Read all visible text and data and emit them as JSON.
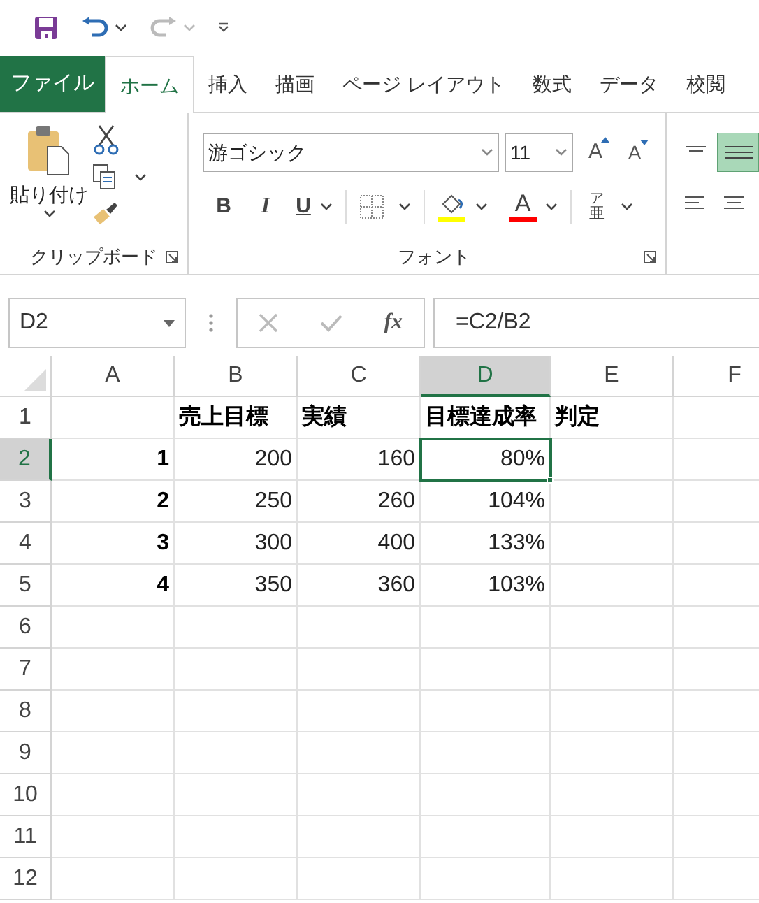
{
  "ribbon_tabs": [
    {
      "label": "ファイル",
      "kind": "file",
      "selected": false
    },
    {
      "label": "ホーム",
      "kind": "tab",
      "selected": true
    },
    {
      "label": "挿入",
      "kind": "tab",
      "selected": false
    },
    {
      "label": "描画",
      "kind": "tab",
      "selected": false
    },
    {
      "label": "ページ レイアウト",
      "kind": "tab",
      "selected": false
    },
    {
      "label": "数式",
      "kind": "tab",
      "selected": false
    },
    {
      "label": "データ",
      "kind": "tab",
      "selected": false
    },
    {
      "label": "校閲",
      "kind": "tab",
      "selected": false
    }
  ],
  "clipboard": {
    "paste_label": "貼り付け",
    "group_label": "クリップボード"
  },
  "font": {
    "font_name": "游ゴシック",
    "font_size": "11",
    "grow": "A",
    "shrink": "A",
    "bold": "B",
    "italic": "I",
    "underline": "U",
    "font_color": "A",
    "phonetic_top": "ア",
    "phonetic_bottom": "亜",
    "group_label": "フォント"
  },
  "formula_bar": {
    "name_box": "D2",
    "fx": "fx",
    "formula": "=C2/B2"
  },
  "columns": [
    {
      "label": "A",
      "selected": false
    },
    {
      "label": "B",
      "selected": false
    },
    {
      "label": "C",
      "selected": false
    },
    {
      "label": "D",
      "selected": true
    },
    {
      "label": "E",
      "selected": false
    },
    {
      "label": "F",
      "selected": false
    }
  ],
  "rows": [
    {
      "label": "1",
      "selected": false,
      "cells": [
        "",
        "売上目標",
        "実績",
        "目標達成率",
        "判定",
        ""
      ]
    },
    {
      "label": "2",
      "selected": true,
      "cells": [
        "1",
        "200",
        "160",
        "80%",
        "",
        ""
      ]
    },
    {
      "label": "3",
      "selected": false,
      "cells": [
        "2",
        "250",
        "260",
        "104%",
        "",
        ""
      ]
    },
    {
      "label": "4",
      "selected": false,
      "cells": [
        "3",
        "300",
        "400",
        "133%",
        "",
        ""
      ]
    },
    {
      "label": "5",
      "selected": false,
      "cells": [
        "4",
        "350",
        "360",
        "103%",
        "",
        ""
      ]
    },
    {
      "label": "6",
      "selected": false,
      "cells": [
        "",
        "",
        "",
        "",
        "",
        ""
      ]
    },
    {
      "label": "7",
      "selected": false,
      "cells": [
        "",
        "",
        "",
        "",
        "",
        ""
      ]
    },
    {
      "label": "8",
      "selected": false,
      "cells": [
        "",
        "",
        "",
        "",
        "",
        ""
      ]
    },
    {
      "label": "9",
      "selected": false,
      "cells": [
        "",
        "",
        "",
        "",
        "",
        ""
      ]
    },
    {
      "label": "10",
      "selected": false,
      "cells": [
        "",
        "",
        "",
        "",
        "",
        ""
      ]
    },
    {
      "label": "11",
      "selected": false,
      "cells": [
        "",
        "",
        "",
        "",
        "",
        ""
      ]
    },
    {
      "label": "12",
      "selected": false,
      "cells": [
        "",
        "",
        "",
        "",
        "",
        ""
      ]
    }
  ]
}
